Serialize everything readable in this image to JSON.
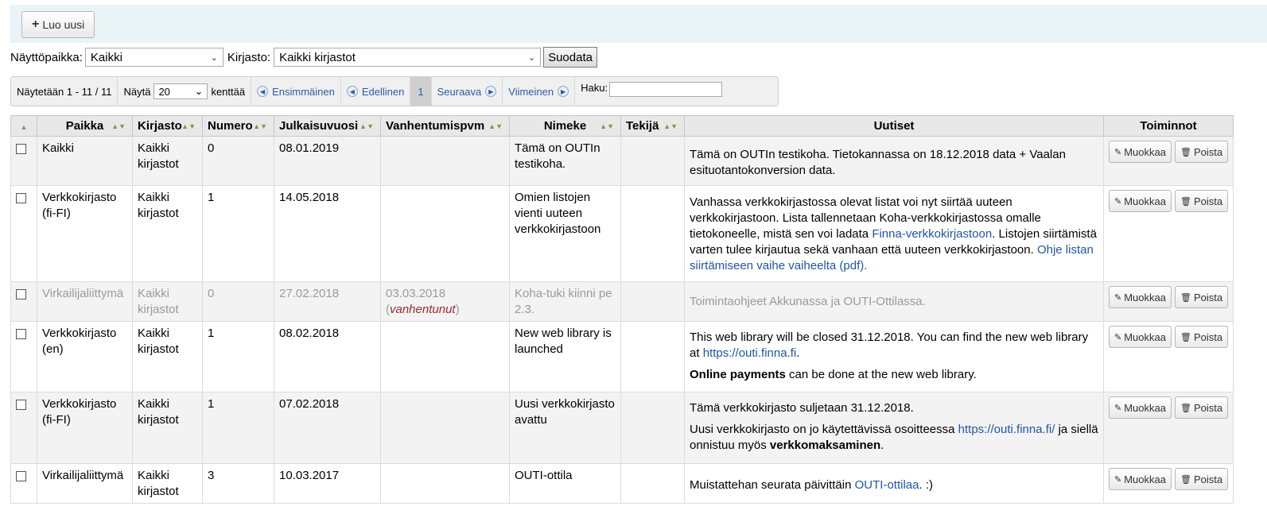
{
  "toolbar": {
    "new_label": "Luo uusi"
  },
  "filters": {
    "location_label": "Näyttöpaikka:",
    "location_value": "Kaikki",
    "library_label": "Kirjasto:",
    "library_value": "Kaikki kirjastot",
    "submit_label": "Suodata"
  },
  "pager": {
    "info": "Näytetään 1 - 11 / 11",
    "show_label": "Näytä",
    "page_size": "20",
    "entries_label": "kenttää",
    "first": "Ensimmäinen",
    "previous": "Edellinen",
    "current_page": "1",
    "next": "Seuraava",
    "last": "Viimeinen",
    "search_label": "Haku:"
  },
  "table": {
    "headers": {
      "location": "Paikka",
      "library": "Kirjasto",
      "number": "Numero",
      "published": "Julkaisuvuosi",
      "expiration": "Vanhentumispvm",
      "title": "Nimeke",
      "author": "Tekijä",
      "news": "Uutiset",
      "actions": "Toiminnot"
    },
    "edit_label": "Muokkaa",
    "delete_label": "Poista",
    "expired_word": "vanhentunut",
    "rows": [
      {
        "location": "Kaikki",
        "library": "Kaikki kirjastot",
        "number": "0",
        "published": "08.01.2019",
        "expiration": "",
        "title": "Tämä on OUTIn testikoha.",
        "author": "",
        "news_1": "Tämä on OUTIn testikoha. Tietokannassa on 18.12.2018 data + Vaalan esituotantokonversion data."
      },
      {
        "location": "Verkkokirjasto (fi-FI)",
        "library": "Kaikki kirjastot",
        "number": "1",
        "published": "14.05.2018",
        "expiration": "",
        "title": "Omien listojen vienti uuteen verkkokirjastoon",
        "author": "",
        "news_1": "Vanhassa verkkokirjastossa olevat listat voi nyt siirtää uuteen verkkokirjastoon. Lista tallennetaan Koha-verkkokirjastossa omalle tietokoneelle, mistä sen voi ladata ",
        "news_link_1": "Finna-verkkokirjastoon",
        "news_2": ". Listojen siirtämistä varten tulee kirjautua sekä vanhaan että uuteen verkkokirjastoon. ",
        "news_link_2": "Ohje listan siirtämiseen vaihe vaiheelta (pdf)."
      },
      {
        "location": "Virkailijaliittymä",
        "library": "Kaikki kirjastot",
        "number": "0",
        "published": "27.02.2018",
        "expiration": "03.03.2018",
        "title": "Koha-tuki kiinni pe 2.3.",
        "author": "",
        "news_1": "Toimintaohjeet Akkunassa ja OUTI-Ottilassa."
      },
      {
        "location": "Verkkokirjasto (en)",
        "library": "Kaikki kirjastot",
        "number": "1",
        "published": "08.02.2018",
        "expiration": "",
        "title": "New web library is launched",
        "author": "",
        "news_1": "This web library will be closed 31.12.2018. You can find the new web library at ",
        "news_link_1": "https://outi.finna.fi",
        "news_2": ".",
        "news_bold": "Online payments",
        "news_3": " can be done at the new web library."
      },
      {
        "location": "Verkkokirjasto (fi-FI)",
        "library": "Kaikki kirjastot",
        "number": "1",
        "published": "07.02.2018",
        "expiration": "",
        "title": "Uusi verkkokirjasto avattu",
        "author": "",
        "news_1": "Tämä verkkokirjasto suljetaan 31.12.2018.",
        "news_2": "Uusi verkkokirjasto on jo käytettävissä osoitteessa ",
        "news_link_1": "https://outi.finna.fi/",
        "news_3": " ja siellä onnistuu myös ",
        "news_bold": "verkkomaksaminen",
        "news_4": "."
      },
      {
        "location": "Virkailijaliittymä",
        "library": "Kaikki kirjastot",
        "number": "3",
        "published": "10.03.2017",
        "expiration": "",
        "title": "OUTI-ottila",
        "author": "",
        "news_1": "Muistattehan seurata päivittäin ",
        "news_link_1": "OUTI-ottilaa",
        "news_2": ". :)"
      }
    ]
  }
}
